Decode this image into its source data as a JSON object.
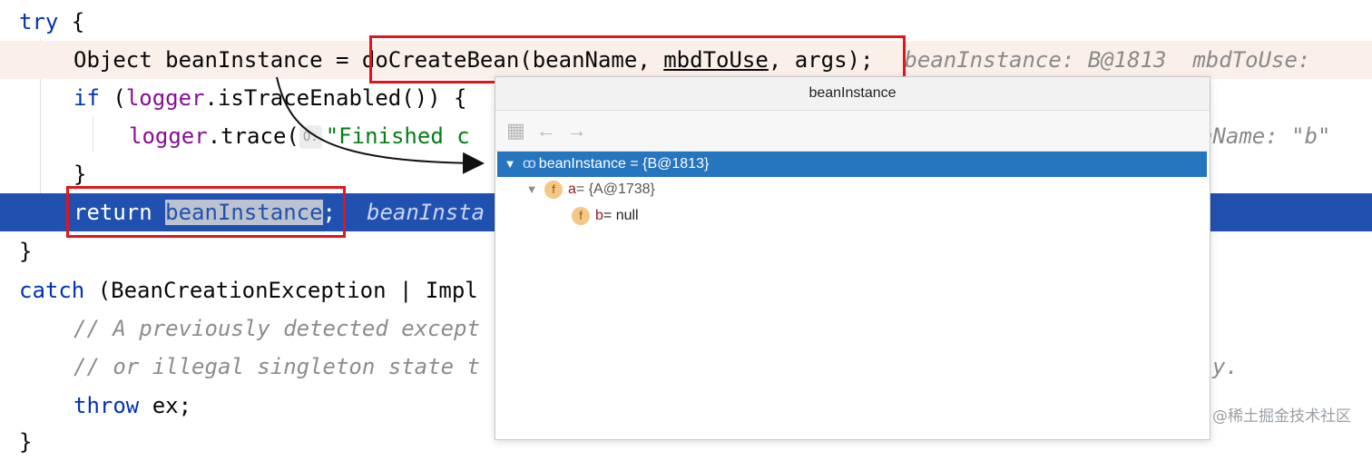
{
  "code": {
    "l1_try": "try",
    "l1_brace": " {",
    "l2_pre": "Object beanInstance = ",
    "l2_call": "doCreateBean",
    "l2_paren_open": "(",
    "l2_arg1": "beanName, ",
    "l2_arg2": "mbdToUse",
    "l2_arg3": ", args)",
    "l2_semi": ";",
    "l2_hint": "beanInstance: B@1813  mbdToUse:",
    "l3_if": "if",
    "l3_mid": " (",
    "l3_logger": "logger",
    "l3_rest": ".isTraceEnabled()) {",
    "l4_logger": "logger",
    "l4_call": ".trace(",
    "l4_param_hint": "O:",
    "l4_str": "\"Finished c",
    "l4_right": "nName: \"b\"",
    "l5_brace": "}",
    "l6_return": "return",
    "l6_space": " ",
    "l6_sel": "beanInstance",
    "l6_semi": ";",
    "l6_hint": "beanInsta",
    "l7_brace": "}",
    "l8_catch": "catch",
    "l8_rest": " (BeanCreationException | Impl",
    "l9_comment": "// A previously detected except",
    "l10_comment": "// or illegal singleton state t",
    "l10_tail": "y.",
    "l11_throw": "throw",
    "l11_rest": " ex;",
    "l12_brace": "}"
  },
  "popup": {
    "title": "beanInstance",
    "toolbar_icons": [
      "watch-icon",
      "back-arrow-icon",
      "forward-arrow-icon"
    ],
    "rows": [
      {
        "label": "beanInstance = {B@1813}"
      },
      {
        "badge": "f",
        "name": "a",
        "value": " = {A@1738}"
      },
      {
        "badge": "f",
        "name": "b",
        "value": " = null"
      }
    ]
  },
  "watermark": "@稀土掘金技术社区",
  "colors": {
    "current_line": "#2151b0",
    "exec_line": "#fbefe9",
    "highlight_box": "#e0161c",
    "selected_row": "#2675bf",
    "keyword": "#0033b3"
  }
}
